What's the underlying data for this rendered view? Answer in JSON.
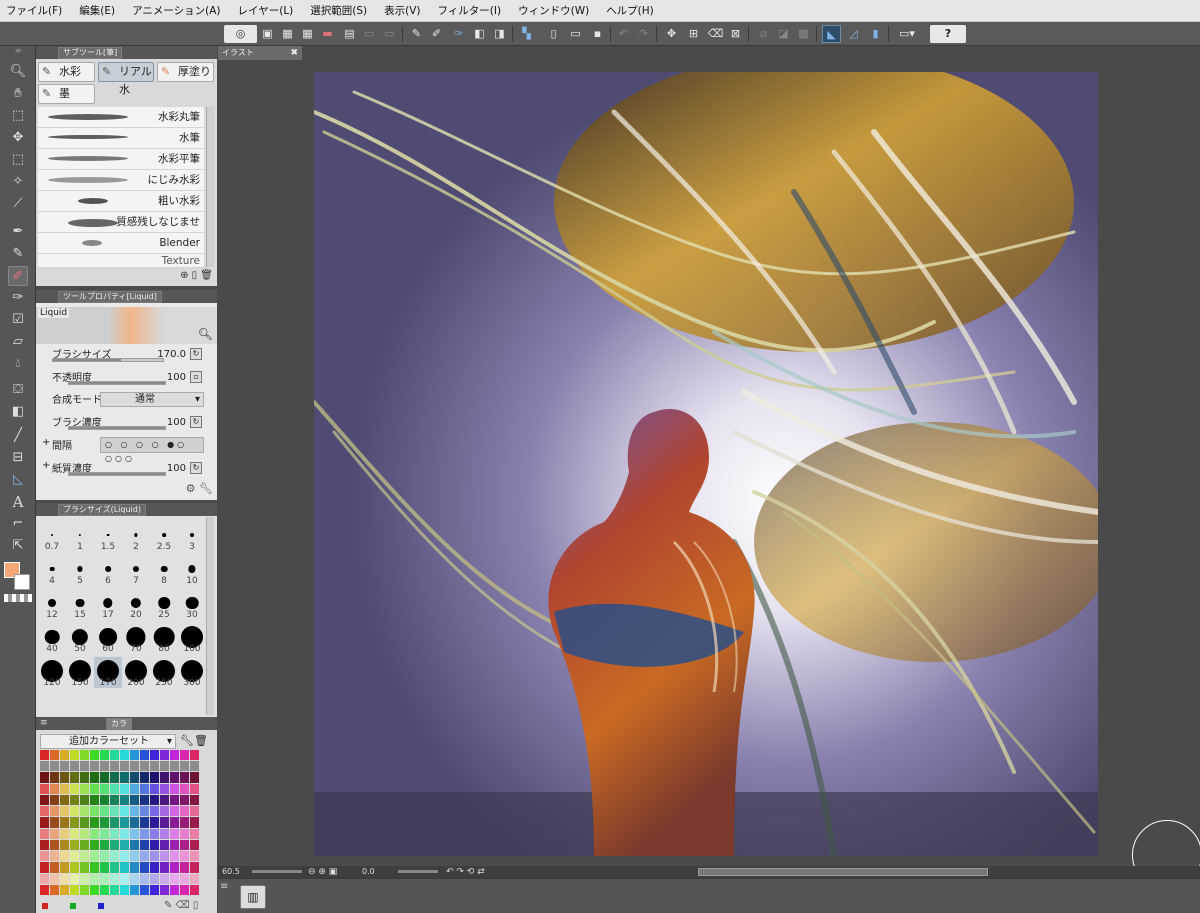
{
  "menu": [
    "ファイル(F)",
    "編集(E)",
    "アニメーション(A)",
    "レイヤー(L)",
    "選択範囲(S)",
    "表示(V)",
    "フィルター(I)",
    "ウィンドウ(W)",
    "ヘルプ(H)"
  ],
  "toolbar": {
    "icons": [
      "spiral-logo-icon",
      "save-icon",
      "grid-icon",
      "grid2-icon",
      "film-icon",
      "layer-icon",
      "copy-icon",
      "paste-icon",
      "brush-a-icon",
      "brush-b-icon",
      "brush-c-icon",
      "transparency-icon",
      "layer2-icon",
      "select-icon",
      "new-file-icon",
      "open-file-icon",
      "save-file-icon",
      "undo-icon",
      "redo-icon",
      "transform-icon",
      "scale-icon",
      "deselect-icon",
      "fill-icon",
      "crop-icon",
      "invert-icon",
      "checker-icon",
      "ruler-icon",
      "shape-icon",
      "lock-icon",
      "monitor-icon",
      "help-icon"
    ],
    "help_label": "?"
  },
  "left_tools": [
    "hand-icon",
    "zoom-icon",
    "move-icon",
    "operation-icon",
    "select-icon",
    "magic-wand-icon",
    "eyedropper-icon",
    "pen-icon",
    "pencil-icon",
    "brush-icon",
    "airbrush-icon",
    "decoration-icon",
    "eraser-icon",
    "blend-icon",
    "fill-icon",
    "gradient-icon",
    "line-icon",
    "frame-icon",
    "ruler-icon",
    "text-icon",
    "balloon-icon",
    "correction-icon"
  ],
  "subtool": {
    "header": "サブツール[筆]",
    "tabs": [
      "水彩",
      "リアル水",
      "厚塗り",
      "墨"
    ],
    "selected_tab": "リアル水",
    "brushes": [
      "水彩丸筆",
      "水筆",
      "水彩平筆",
      "にじみ水彩",
      "粗い水彩",
      "質感残しなじませ",
      "Blender",
      "Texture"
    ]
  },
  "tool_property": {
    "header": "ツールプロパティ[Liquid]",
    "preview_label": "Liquid",
    "props": [
      {
        "label": "ブラシサイズ",
        "value": "170.0",
        "fill": 0.62
      },
      {
        "label": "不透明度",
        "value": "100",
        "fill": 1.0
      },
      {
        "label": "合成モード",
        "value": "通常",
        "fill": null
      },
      {
        "label": "ブラシ濃度",
        "value": "100",
        "fill": 1.0
      },
      {
        "label": "間隔",
        "value": "",
        "fill": null
      },
      {
        "label": "紙質濃度",
        "value": "100",
        "fill": 1.0
      }
    ]
  },
  "brush_size": {
    "header": "ブラシサイズ(Liquid)",
    "sizes": [
      "0.7",
      "1",
      "1.5",
      "2",
      "2.5",
      "3",
      "4",
      "5",
      "6",
      "7",
      "8",
      "10",
      "12",
      "15",
      "17",
      "20",
      "25",
      "30",
      "40",
      "50",
      "60",
      "70",
      "80",
      "100",
      "120",
      "150",
      "170",
      "200",
      "250",
      "300"
    ],
    "selected": "170"
  },
  "color_set": {
    "header": "カラ",
    "title": "追加カラーセット"
  },
  "document": {
    "tab": "イラスト"
  },
  "status": {
    "zoom": "60.5",
    "rotation": "0.0"
  }
}
